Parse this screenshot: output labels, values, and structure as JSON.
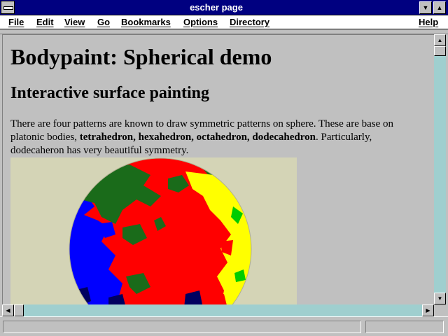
{
  "window": {
    "title": "escher page"
  },
  "menubar": {
    "items": [
      "File",
      "Edit",
      "View",
      "Go",
      "Bookmarks",
      "Options",
      "Directory",
      "Help"
    ]
  },
  "titlebar": {
    "minimize_icon": "down-triangle-icon",
    "maximize_icon": "up-triangle-icon"
  },
  "page": {
    "heading": "Bodypaint: Spherical demo",
    "subheading": "Interactive surface painting",
    "para_intro": "There are four patterns are known to draw symmetric patterns on sphere. These are base on platonic bodies, ",
    "para_bold": "tetrahedron, hexahedron, octahedron, dodecahedron",
    "para_outro": ". Particularly, dodecaheron has very beautiful symmetry."
  },
  "image": {
    "name": "painted-sphere",
    "background": "#d4d4b6",
    "colors": {
      "red": "#ff0000",
      "blue": "#0000ff",
      "green": "#1a6b1a",
      "yellow": "#ffff00",
      "magenta": "#ff00ff",
      "navy": "#000060"
    }
  },
  "scrollbars": {
    "up_icon": "up-arrow-icon",
    "down_icon": "down-arrow-icon",
    "left_icon": "left-arrow-icon",
    "right_icon": "right-arrow-icon"
  },
  "statusbar": {
    "text": ""
  }
}
